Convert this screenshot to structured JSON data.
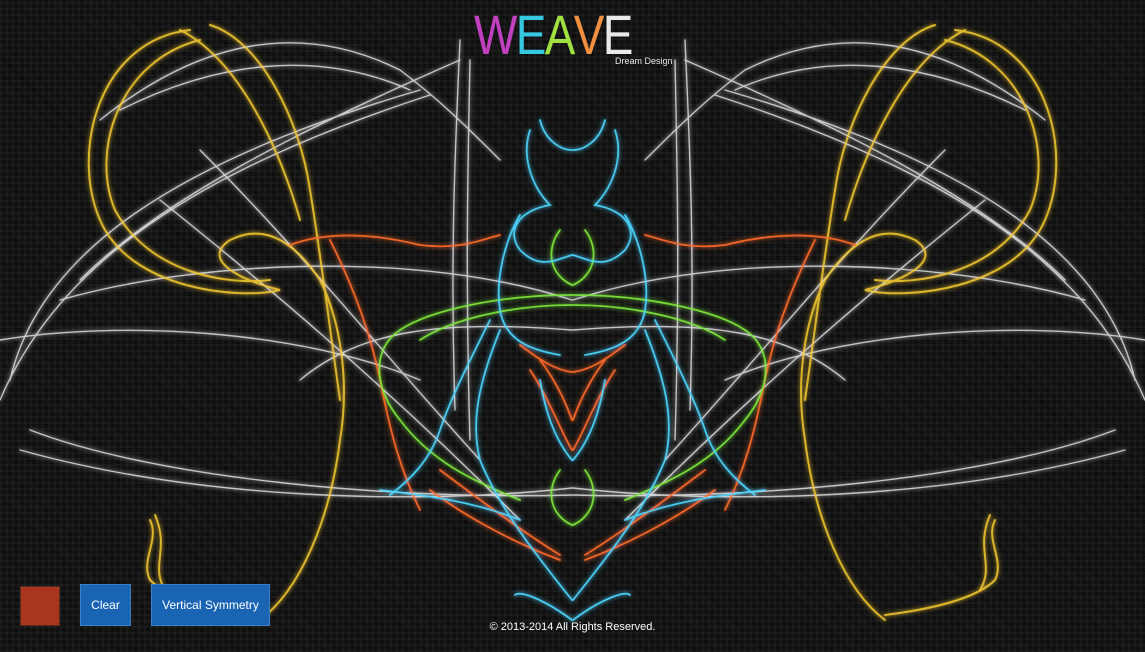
{
  "app": {
    "logo_text": "WEAVE",
    "logo_letter_colors": [
      "#c040c0",
      "#35c8e0",
      "#a0e040",
      "#f09040",
      "#e8e8e8"
    ],
    "logo_subtitle": "Dream Design"
  },
  "colors": {
    "background": "#111111",
    "yellow_stroke": "#f2c830",
    "white_stroke": "#f0f0f0",
    "orange_stroke": "#ff6a2a",
    "cyan_stroke": "#4cd6ff",
    "green_stroke": "#7de83a",
    "selected_color": "#a8361e",
    "button_bg": "#1a64b4"
  },
  "controls": {
    "color_swatch_label": "Brush color",
    "clear_label": "Clear",
    "symmetry_label": "Vertical Symmetry"
  },
  "footer": {
    "text": "© 2013-2014 All Rights Reserved."
  }
}
